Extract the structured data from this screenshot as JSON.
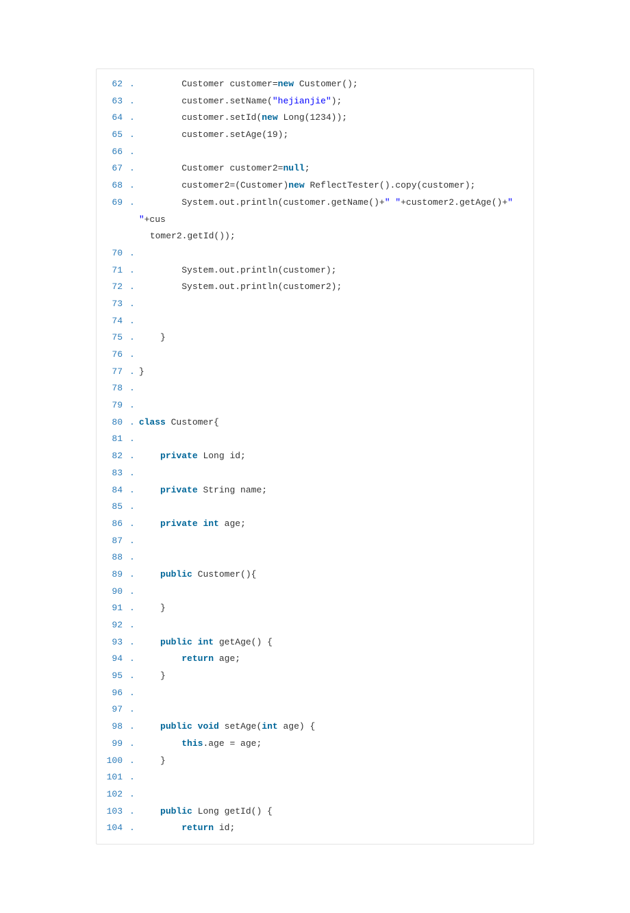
{
  "lines": [
    {
      "n": "62",
      "segs": [
        {
          "t": "        Customer customer="
        },
        {
          "t": "new",
          "c": "kw"
        },
        {
          "t": " Customer();  "
        }
      ]
    },
    {
      "n": "63",
      "segs": [
        {
          "t": "        customer.setName("
        },
        {
          "t": "\"hejianjie\"",
          "c": "str"
        },
        {
          "t": ");  "
        }
      ]
    },
    {
      "n": "64",
      "segs": [
        {
          "t": "        customer.setId("
        },
        {
          "t": "new",
          "c": "kw"
        },
        {
          "t": " Long(1234));  "
        }
      ]
    },
    {
      "n": "65",
      "segs": [
        {
          "t": "        customer.setAge(19);  "
        }
      ]
    },
    {
      "n": "66",
      "segs": [
        {
          "t": "  "
        }
      ]
    },
    {
      "n": "67",
      "segs": [
        {
          "t": "        Customer customer2="
        },
        {
          "t": "null",
          "c": "kw"
        },
        {
          "t": ";  "
        }
      ]
    },
    {
      "n": "68",
      "segs": [
        {
          "t": "        customer2=(Customer)"
        },
        {
          "t": "new",
          "c": "kw"
        },
        {
          "t": " ReflectTester().copy(customer);  "
        }
      ]
    },
    {
      "n": "69",
      "segs": [
        {
          "t": "        System.out.println(customer.getName()+"
        },
        {
          "t": "\" \"",
          "c": "str"
        },
        {
          "t": "+customer2.getAge()+"
        },
        {
          "t": "\" \"",
          "c": "str"
        },
        {
          "t": "+cus"
        }
      ],
      "wrap": "tomer2.getId());  "
    },
    {
      "n": "70",
      "segs": [
        {
          "t": "          "
        }
      ]
    },
    {
      "n": "71",
      "segs": [
        {
          "t": "        System.out.println(customer);  "
        }
      ]
    },
    {
      "n": "72",
      "segs": [
        {
          "t": "        System.out.println(customer2);  "
        }
      ]
    },
    {
      "n": "73",
      "segs": [
        {
          "t": "          "
        }
      ]
    },
    {
      "n": "74",
      "segs": [
        {
          "t": "  "
        }
      ]
    },
    {
      "n": "75",
      "segs": [
        {
          "t": "    }  "
        }
      ]
    },
    {
      "n": "76",
      "segs": [
        {
          "t": "  "
        }
      ]
    },
    {
      "n": "77",
      "segs": [
        {
          "t": "}  "
        }
      ]
    },
    {
      "n": "78",
      "segs": [
        {
          "t": "  "
        }
      ]
    },
    {
      "n": "79",
      "segs": [
        {
          "t": "  "
        }
      ]
    },
    {
      "n": "80",
      "segs": [
        {
          "t": "class",
          "c": "kw"
        },
        {
          "t": " Customer{  "
        }
      ]
    },
    {
      "n": "81",
      "segs": [
        {
          "t": "      "
        }
      ]
    },
    {
      "n": "82",
      "segs": [
        {
          "t": "    "
        },
        {
          "t": "private",
          "c": "kw"
        },
        {
          "t": " Long id;  "
        }
      ]
    },
    {
      "n": "83",
      "segs": [
        {
          "t": "      "
        }
      ]
    },
    {
      "n": "84",
      "segs": [
        {
          "t": "    "
        },
        {
          "t": "private",
          "c": "kw"
        },
        {
          "t": " String name;  "
        }
      ]
    },
    {
      "n": "85",
      "segs": [
        {
          "t": "      "
        }
      ]
    },
    {
      "n": "86",
      "segs": [
        {
          "t": "    "
        },
        {
          "t": "private",
          "c": "kw"
        },
        {
          "t": " "
        },
        {
          "t": "int",
          "c": "kw"
        },
        {
          "t": " age;  "
        }
      ]
    },
    {
      "n": "87",
      "segs": [
        {
          "t": "      "
        }
      ]
    },
    {
      "n": "88",
      "segs": [
        {
          "t": "  "
        }
      ]
    },
    {
      "n": "89",
      "segs": [
        {
          "t": "    "
        },
        {
          "t": "public",
          "c": "kw"
        },
        {
          "t": " Customer(){  "
        }
      ]
    },
    {
      "n": "90",
      "segs": [
        {
          "t": "          "
        }
      ]
    },
    {
      "n": "91",
      "segs": [
        {
          "t": "    }  "
        }
      ]
    },
    {
      "n": "92",
      "segs": [
        {
          "t": "  "
        }
      ]
    },
    {
      "n": "93",
      "segs": [
        {
          "t": "    "
        },
        {
          "t": "public",
          "c": "kw"
        },
        {
          "t": " "
        },
        {
          "t": "int",
          "c": "kw"
        },
        {
          "t": " getAge() {  "
        }
      ]
    },
    {
      "n": "94",
      "segs": [
        {
          "t": "        "
        },
        {
          "t": "return",
          "c": "kw"
        },
        {
          "t": " age;  "
        }
      ]
    },
    {
      "n": "95",
      "segs": [
        {
          "t": "    }  "
        }
      ]
    },
    {
      "n": "96",
      "segs": [
        {
          "t": "  "
        }
      ]
    },
    {
      "n": "97",
      "segs": [
        {
          "t": "  "
        }
      ]
    },
    {
      "n": "98",
      "segs": [
        {
          "t": "    "
        },
        {
          "t": "public",
          "c": "kw"
        },
        {
          "t": " "
        },
        {
          "t": "void",
          "c": "kw"
        },
        {
          "t": " setAge("
        },
        {
          "t": "int",
          "c": "kw"
        },
        {
          "t": " age) {  "
        }
      ]
    },
    {
      "n": "99",
      "segs": [
        {
          "t": "        "
        },
        {
          "t": "this",
          "c": "kw"
        },
        {
          "t": ".age = age;  "
        }
      ]
    },
    {
      "n": "100",
      "segs": [
        {
          "t": "    }  "
        }
      ]
    },
    {
      "n": "101",
      "segs": [
        {
          "t": "  "
        }
      ]
    },
    {
      "n": "102",
      "segs": [
        {
          "t": "  "
        }
      ]
    },
    {
      "n": "103",
      "segs": [
        {
          "t": "    "
        },
        {
          "t": "public",
          "c": "kw"
        },
        {
          "t": " Long getId() {  "
        }
      ]
    },
    {
      "n": "104",
      "segs": [
        {
          "t": "        "
        },
        {
          "t": "return",
          "c": "kw"
        },
        {
          "t": " id;  "
        }
      ]
    }
  ]
}
